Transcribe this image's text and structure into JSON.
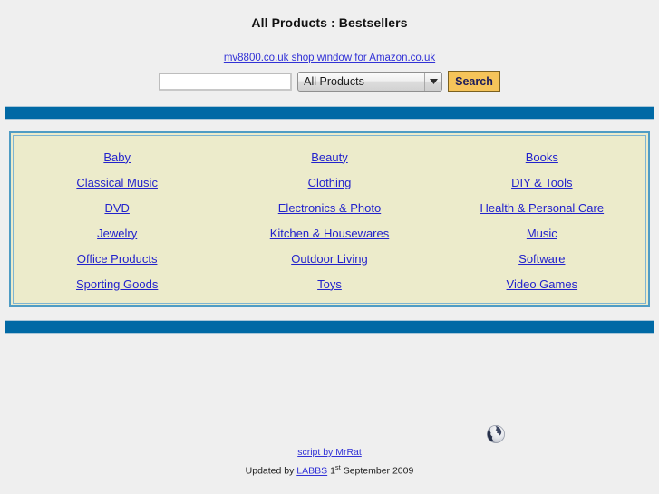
{
  "header": {
    "title": "All Products : Bestsellers",
    "shop_window_link": "mv8800.co.uk shop window for Amazon.co.uk"
  },
  "search": {
    "input_value": "",
    "input_placeholder": "",
    "selected_category": "All Products",
    "category_options": [
      "All Products"
    ],
    "button_label": "Search",
    "dropdown_icon": "chevron-down-icon",
    "button_color": "#f5c45a"
  },
  "categories": {
    "rows": [
      [
        "Baby",
        "Beauty",
        "Books"
      ],
      [
        "Classical Music",
        "Clothing",
        "DIY & Tools"
      ],
      [
        "DVD",
        "Electronics & Photo",
        "Health & Personal Care"
      ],
      [
        "Jewelry",
        "Kitchen & Housewares",
        "Music"
      ],
      [
        "Office Products",
        "Outdoor Living",
        "Software"
      ],
      [
        "Sporting Goods",
        "Toys",
        "Video Games"
      ]
    ],
    "box_background": "#ecebcb",
    "border_color": "#4f9cc4",
    "link_color": "#2222cc"
  },
  "separators": {
    "color": "#0069a5"
  },
  "footer": {
    "globe_icon": "globe-icon",
    "script_credit_text": "script by MrRat",
    "updated_prefix": "Updated by",
    "updated_link": "LABBS",
    "updated_day": "1",
    "updated_day_suffix": "st",
    "updated_rest": "September 2009"
  }
}
